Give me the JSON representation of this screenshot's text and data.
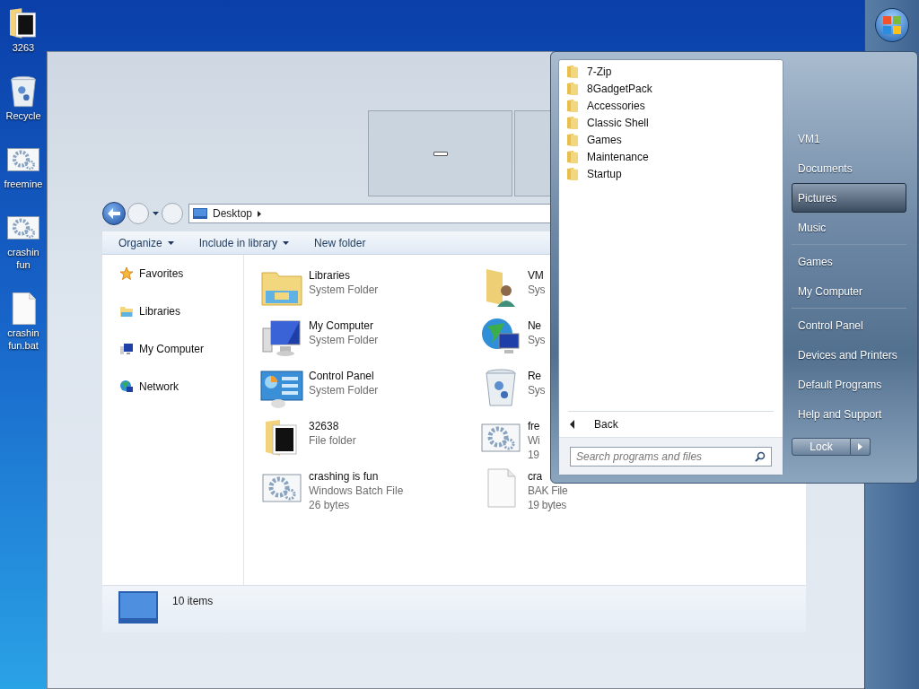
{
  "desktop_icons": [
    {
      "kind": "folder",
      "lines": [
        "3263"
      ]
    },
    {
      "kind": "recycle",
      "lines": [
        "Recycle"
      ]
    },
    {
      "kind": "batch",
      "lines": [
        "freemine"
      ]
    },
    {
      "kind": "batch",
      "lines": [
        "crashin",
        "fun"
      ]
    },
    {
      "kind": "file",
      "lines": [
        "crashin",
        "fun.bat"
      ]
    }
  ],
  "explorer": {
    "address": "Desktop",
    "toolbar": [
      {
        "label": "Organize",
        "dropdown": true
      },
      {
        "label": "Include in library",
        "dropdown": true
      },
      {
        "label": "New folder",
        "dropdown": false
      }
    ],
    "nav": [
      {
        "kind": "star",
        "label": "Favorites"
      },
      {
        "kind": "libraries",
        "label": "Libraries"
      },
      {
        "kind": "computer",
        "label": "My Computer"
      },
      {
        "kind": "network",
        "label": "Network"
      }
    ],
    "items": [
      {
        "kind": "libraries",
        "name": "Libraries",
        "details": [
          "System Folder"
        ]
      },
      {
        "kind": "user",
        "name": "VM",
        "details": [
          "Sys"
        ]
      },
      {
        "kind": "computer",
        "name": "My Computer",
        "details": [
          "System Folder"
        ]
      },
      {
        "kind": "network",
        "name": "Ne",
        "details": [
          "Sys"
        ]
      },
      {
        "kind": "control",
        "name": "Control Panel",
        "details": [
          "System Folder"
        ]
      },
      {
        "kind": "recycle",
        "name": "Re",
        "details": [
          "Sys"
        ]
      },
      {
        "kind": "folder",
        "name": "32638",
        "details": [
          "File folder"
        ]
      },
      {
        "kind": "batch",
        "name": "fre",
        "details": [
          "Wi",
          "19"
        ]
      },
      {
        "kind": "batch",
        "name": "crashing is fun",
        "details": [
          "Windows Batch File",
          "26 bytes"
        ]
      },
      {
        "kind": "file",
        "name": "cra",
        "details": [
          "BAK File",
          "19 bytes"
        ]
      }
    ],
    "status": "10 items"
  },
  "start_menu": {
    "programs": [
      "7-Zip",
      "8GadgetPack",
      "Accessories",
      "Classic Shell",
      "Games",
      "Maintenance",
      "Startup"
    ],
    "back": "Back",
    "search": {
      "placeholder": "Search programs and files"
    },
    "place_groups": [
      [
        {
          "label": "VM1",
          "selected": false
        },
        {
          "label": "Documents",
          "selected": false
        },
        {
          "label": "Pictures",
          "selected": true
        },
        {
          "label": "Music",
          "selected": false
        }
      ],
      [
        {
          "label": "Games",
          "selected": false
        },
        {
          "label": "My Computer",
          "selected": false
        }
      ],
      [
        {
          "label": "Control Panel",
          "selected": false
        },
        {
          "label": "Devices and Printers",
          "selected": false
        },
        {
          "label": "Default Programs",
          "selected": false
        },
        {
          "label": "Help and Support",
          "selected": false
        }
      ]
    ],
    "lock": "Lock"
  }
}
